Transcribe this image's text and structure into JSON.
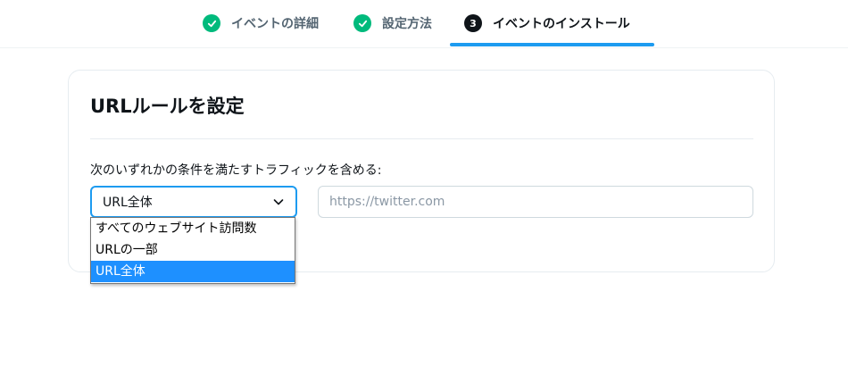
{
  "stepper": {
    "steps": [
      {
        "label": "イベントの詳細",
        "status": "done",
        "icon": "check-icon"
      },
      {
        "label": "設定方法",
        "status": "done",
        "icon": "check-icon"
      },
      {
        "label": "イベントのインストール",
        "status": "current",
        "number": "3"
      }
    ],
    "colors": {
      "done": "#00ba7c",
      "active_underline": "#1d9bf0"
    }
  },
  "card": {
    "title": "URLルールを設定",
    "rule_label": "次のいずれかの条件を満たすトラフィックを含める:",
    "select": {
      "selected": "URL全体",
      "options": [
        "すべてのウェブサイト訪問数",
        "URLの一部",
        "URL全体"
      ]
    },
    "url_input": {
      "value": "",
      "placeholder": "https://twitter.com"
    }
  }
}
